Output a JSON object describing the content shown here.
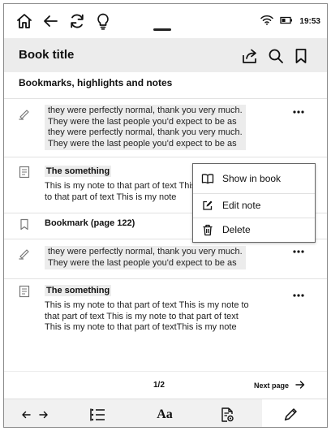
{
  "status_bar": {
    "time": "19:53",
    "icons": [
      "home-icon",
      "back-arrow-icon",
      "sync-icon",
      "lightbulb-icon",
      "wifi-icon",
      "battery-icon"
    ]
  },
  "header": {
    "title": "Book title",
    "actions": [
      "share-icon",
      "search-icon",
      "bookmark-icon"
    ]
  },
  "section": {
    "heading": "Bookmarks, highlights and notes"
  },
  "items": [
    {
      "type": "highlight",
      "icon": "highlighter-icon",
      "lines": [
        "they were perfectly normal, thank you very much.",
        "They were the last people you'd expect to be as",
        "they were perfectly normal, thank you very much.",
        "They were the last people you'd expect to be as"
      ],
      "more": "..."
    },
    {
      "type": "note",
      "icon": "note-icon",
      "title": "The something",
      "lines": [
        "This is my note to that part of text This is my note",
        "to that part of text This is my note"
      ]
    },
    {
      "type": "bookmark",
      "icon": "bookmark-icon",
      "title": "Bookmark (page 122)"
    },
    {
      "type": "highlight",
      "icon": "highlighter-icon",
      "lines": [
        "they were perfectly normal, thank you very much.",
        "They were the last people you'd expect to be as"
      ],
      "more": "..."
    },
    {
      "type": "note",
      "icon": "note-icon",
      "title": "The something",
      "lines": [
        "This is my note to that part of text This is my note to",
        "that part of text This is my note to that part of text",
        "This is my note to that part of textThis is my note"
      ],
      "more": "..."
    }
  ],
  "context_menu": {
    "items": [
      {
        "label": "Show in book",
        "icon": "book-icon"
      },
      {
        "label": "Edit note",
        "icon": "edit-icon"
      },
      {
        "label": "Delete",
        "icon": "trash-icon"
      }
    ]
  },
  "pagination": {
    "current": "1/2",
    "next_label": "Next page"
  },
  "toolbar": {
    "buttons": [
      "page-nav-arrows-icon",
      "table-of-contents-icon",
      "font-settings-icon",
      "book-settings-icon",
      "pencil-icon"
    ],
    "font_label": "Aa",
    "active": "pencil-icon"
  },
  "colors": {
    "header_bg": "#ececec",
    "highlight_bg": "#ececec",
    "toolbar_bg": "#f1f1f1",
    "text": "#111111"
  }
}
